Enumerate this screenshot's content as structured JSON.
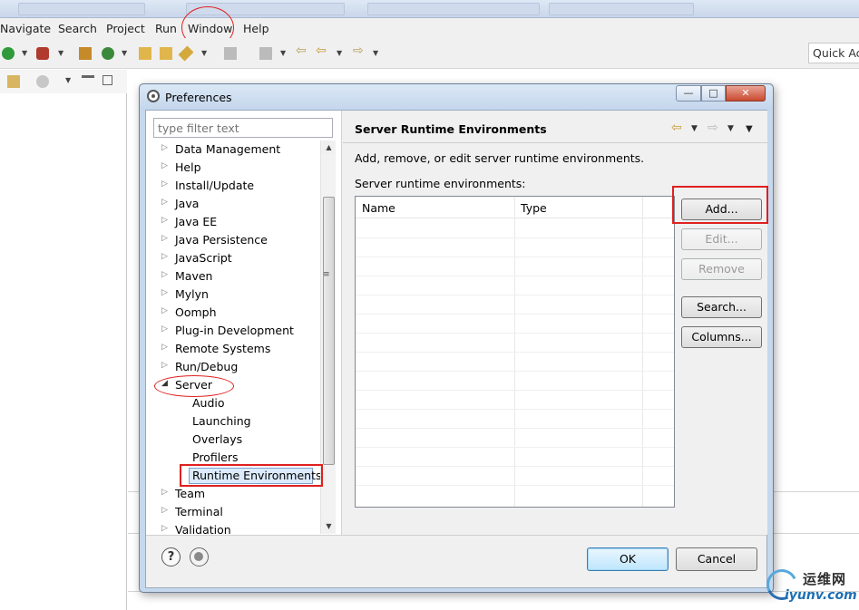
{
  "menubar": {
    "items": [
      "Navigate",
      "Search",
      "Project",
      "Run",
      "Window",
      "Help"
    ]
  },
  "toolbar": {
    "quick_access": "Quick Access"
  },
  "dialog": {
    "title": "Preferences",
    "window_buttons": {
      "minimize": "—",
      "maximize": "□",
      "close": "✕"
    },
    "filter_placeholder": "type filter text",
    "tree": {
      "top_items": [
        "Data Management",
        "Help",
        "Install/Update",
        "Java",
        "Java EE",
        "Java Persistence",
        "JavaScript",
        "Maven",
        "Mylyn",
        "Oomph",
        "Plug-in Development",
        "Remote Systems",
        "Run/Debug"
      ],
      "expanded_item": "Server",
      "server_children": [
        "Audio",
        "Launching",
        "Overlays",
        "Profilers",
        "Runtime Environments"
      ],
      "selected_item": "Runtime Environments",
      "after_items": [
        "Team",
        "Terminal",
        "Validation"
      ]
    },
    "page": {
      "title": "Server Runtime Environments",
      "description": "Add, remove, or edit server runtime environments.",
      "list_label": "Server runtime environments:",
      "columns": [
        "Name",
        "Type"
      ],
      "buttons": {
        "add": "Add...",
        "edit": "Edit...",
        "remove": "Remove",
        "search": "Search...",
        "columns": "Columns..."
      }
    },
    "footer": {
      "help_icon": "?",
      "ok": "OK",
      "cancel": "Cancel"
    }
  },
  "watermark": {
    "cn": "运维网",
    "en": "iyunv.com"
  },
  "colors": {
    "annotation": "#e02020",
    "dialog_frame": "#c6d8ec",
    "selection": "#dcebfc"
  }
}
